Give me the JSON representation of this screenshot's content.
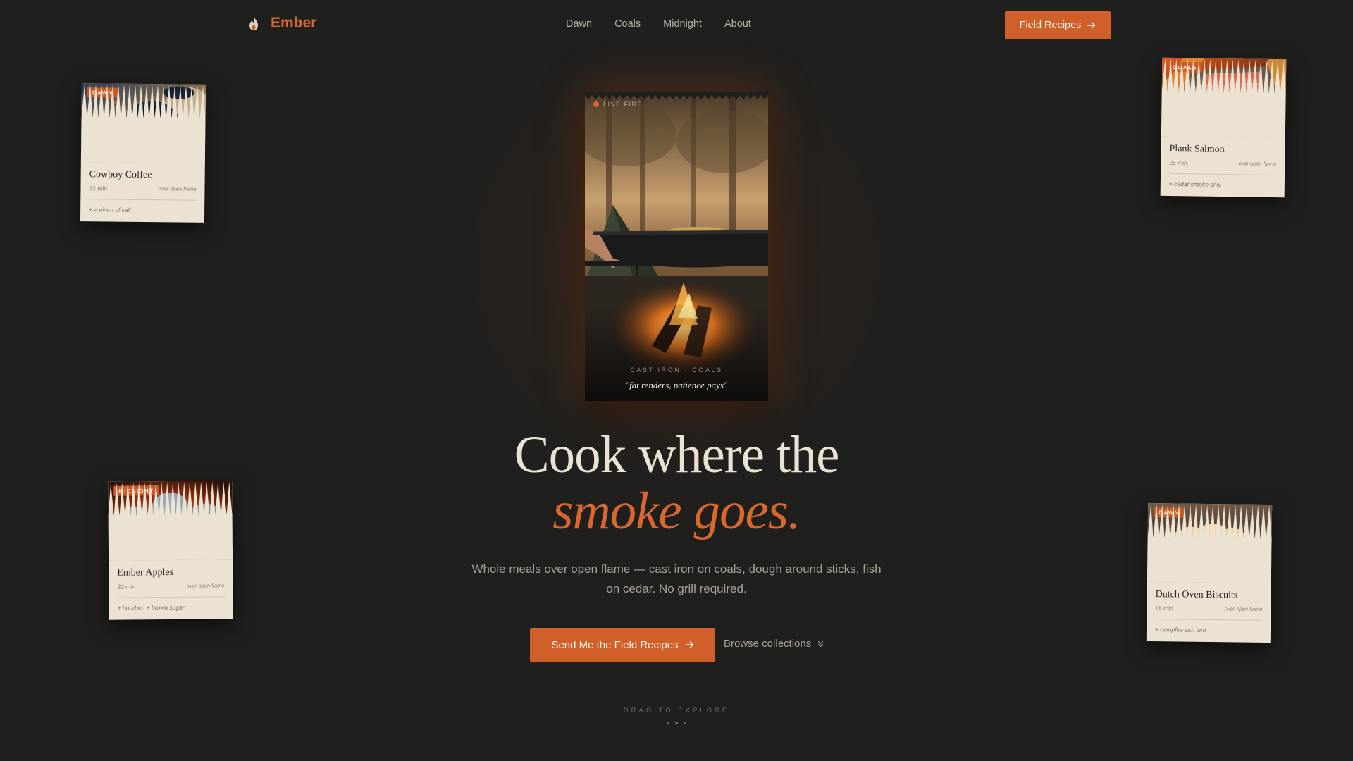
{
  "header": {
    "brand": "Ember",
    "brand_icon": "flame-icon",
    "nav": [
      "Dawn",
      "Coals",
      "Midnight",
      "About"
    ],
    "cta_label": "Field Recipes",
    "cta_icon": "arrow-right-icon"
  },
  "cards": [
    {
      "tag": "DAWN",
      "title": "Cowboy Coffee",
      "time": "12 min",
      "method": "over open flame",
      "note": "+ a pinch of salt"
    },
    {
      "tag": "COALS",
      "title": "Plank Salmon",
      "time": "25 min",
      "method": "over open flame",
      "note": "+ cedar smoke only"
    },
    {
      "tag": "MIDNIGHT",
      "title": "Ember Apples",
      "time": "20 min",
      "method": "over open flame",
      "note": "+ bourbon + brown sugar"
    },
    {
      "tag": "DAWN",
      "title": "Dutch Oven Biscuits",
      "time": "18 min",
      "method": "over open flame",
      "note": "+ campfire ash lard"
    }
  ],
  "hero_photo": {
    "badge": "LIVE FIRE",
    "caption_sub": "CAST IRON · COALS",
    "caption_quote": "\"fat renders, patience pays\""
  },
  "headline": {
    "line1": "Cook where the",
    "line2": "smoke goes."
  },
  "subhead": "Whole meals over open flame — cast iron on coals, dough around sticks, fish on cedar. No grill required.",
  "cta_primary": "Send Me the Field Recipes",
  "cta_secondary": "Browse collections",
  "drag_hint": "DRAG TO EXPLORE",
  "colors": {
    "background": "#1f1f1e",
    "accent": "#d05f2a",
    "accent_text": "#d9672e",
    "card_paper": "#ebe2d2",
    "headline_cream": "#eae2d3"
  }
}
